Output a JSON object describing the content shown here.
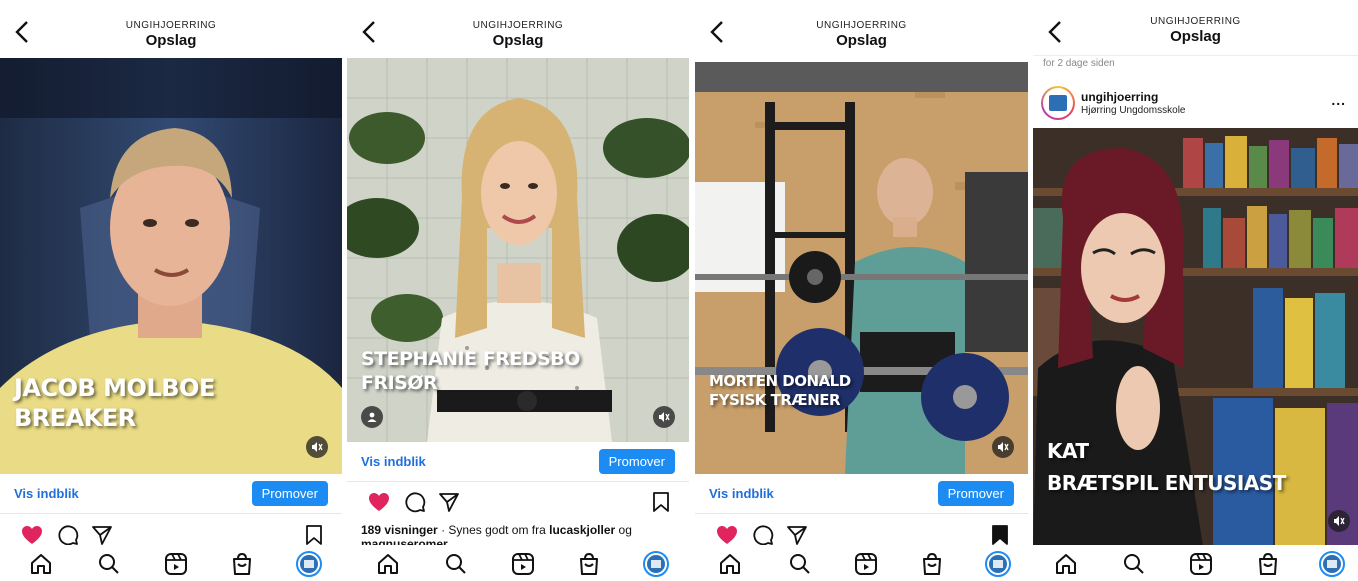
{
  "colors": {
    "accent": "#1d8cf2",
    "link": "#1f6fdc",
    "like": "#e0245e"
  },
  "icons": [
    "back-chevron-icon",
    "mute-icon",
    "heart-icon",
    "comment-icon",
    "send-icon",
    "bookmark-icon",
    "home-icon",
    "search-icon",
    "reels-icon",
    "shop-icon",
    "profile-avatar-icon",
    "user-tag-icon",
    "more-icon"
  ],
  "posts": [
    {
      "account": "UNGIHJOERRING",
      "title": "Opslag",
      "caption_line1": "JACOB MOLBOE",
      "caption_line2": "BREAKER",
      "insights_label": "Vis indblik",
      "promote_label": "Promover",
      "liked": true,
      "saved": false
    },
    {
      "account": "UNGIHJOERRING",
      "title": "Opslag",
      "caption_line1": "STEPHANIE FREDSBO",
      "caption_line2": "FRISØR",
      "insights_label": "Vis indblik",
      "promote_label": "Promover",
      "liked": true,
      "saved": false,
      "views": "189 visninger",
      "separator": "·",
      "likes_prefix": "Synes godt om fra",
      "liker1": "lucaskjoller",
      "liker_joiner": "og",
      "liker2": "magnuseromer"
    },
    {
      "account": "UNGIHJOERRING",
      "title": "Opslag",
      "caption_line1": "MORTEN DONALD",
      "caption_line2": "FYSISK TRÆNER",
      "insights_label": "Vis indblik",
      "promote_label": "Promover",
      "liked": true,
      "saved": true
    },
    {
      "account": "UNGIHJOERRING",
      "title": "Opslag",
      "time_ago": "for 2 dage siden",
      "username": "ungihjoerring",
      "subtitle": "Hjørring Ungdomsskole",
      "more": "...",
      "caption_line1": "KAT",
      "caption_line2": "BRÆTSPIL ENTUSIAST"
    }
  ]
}
